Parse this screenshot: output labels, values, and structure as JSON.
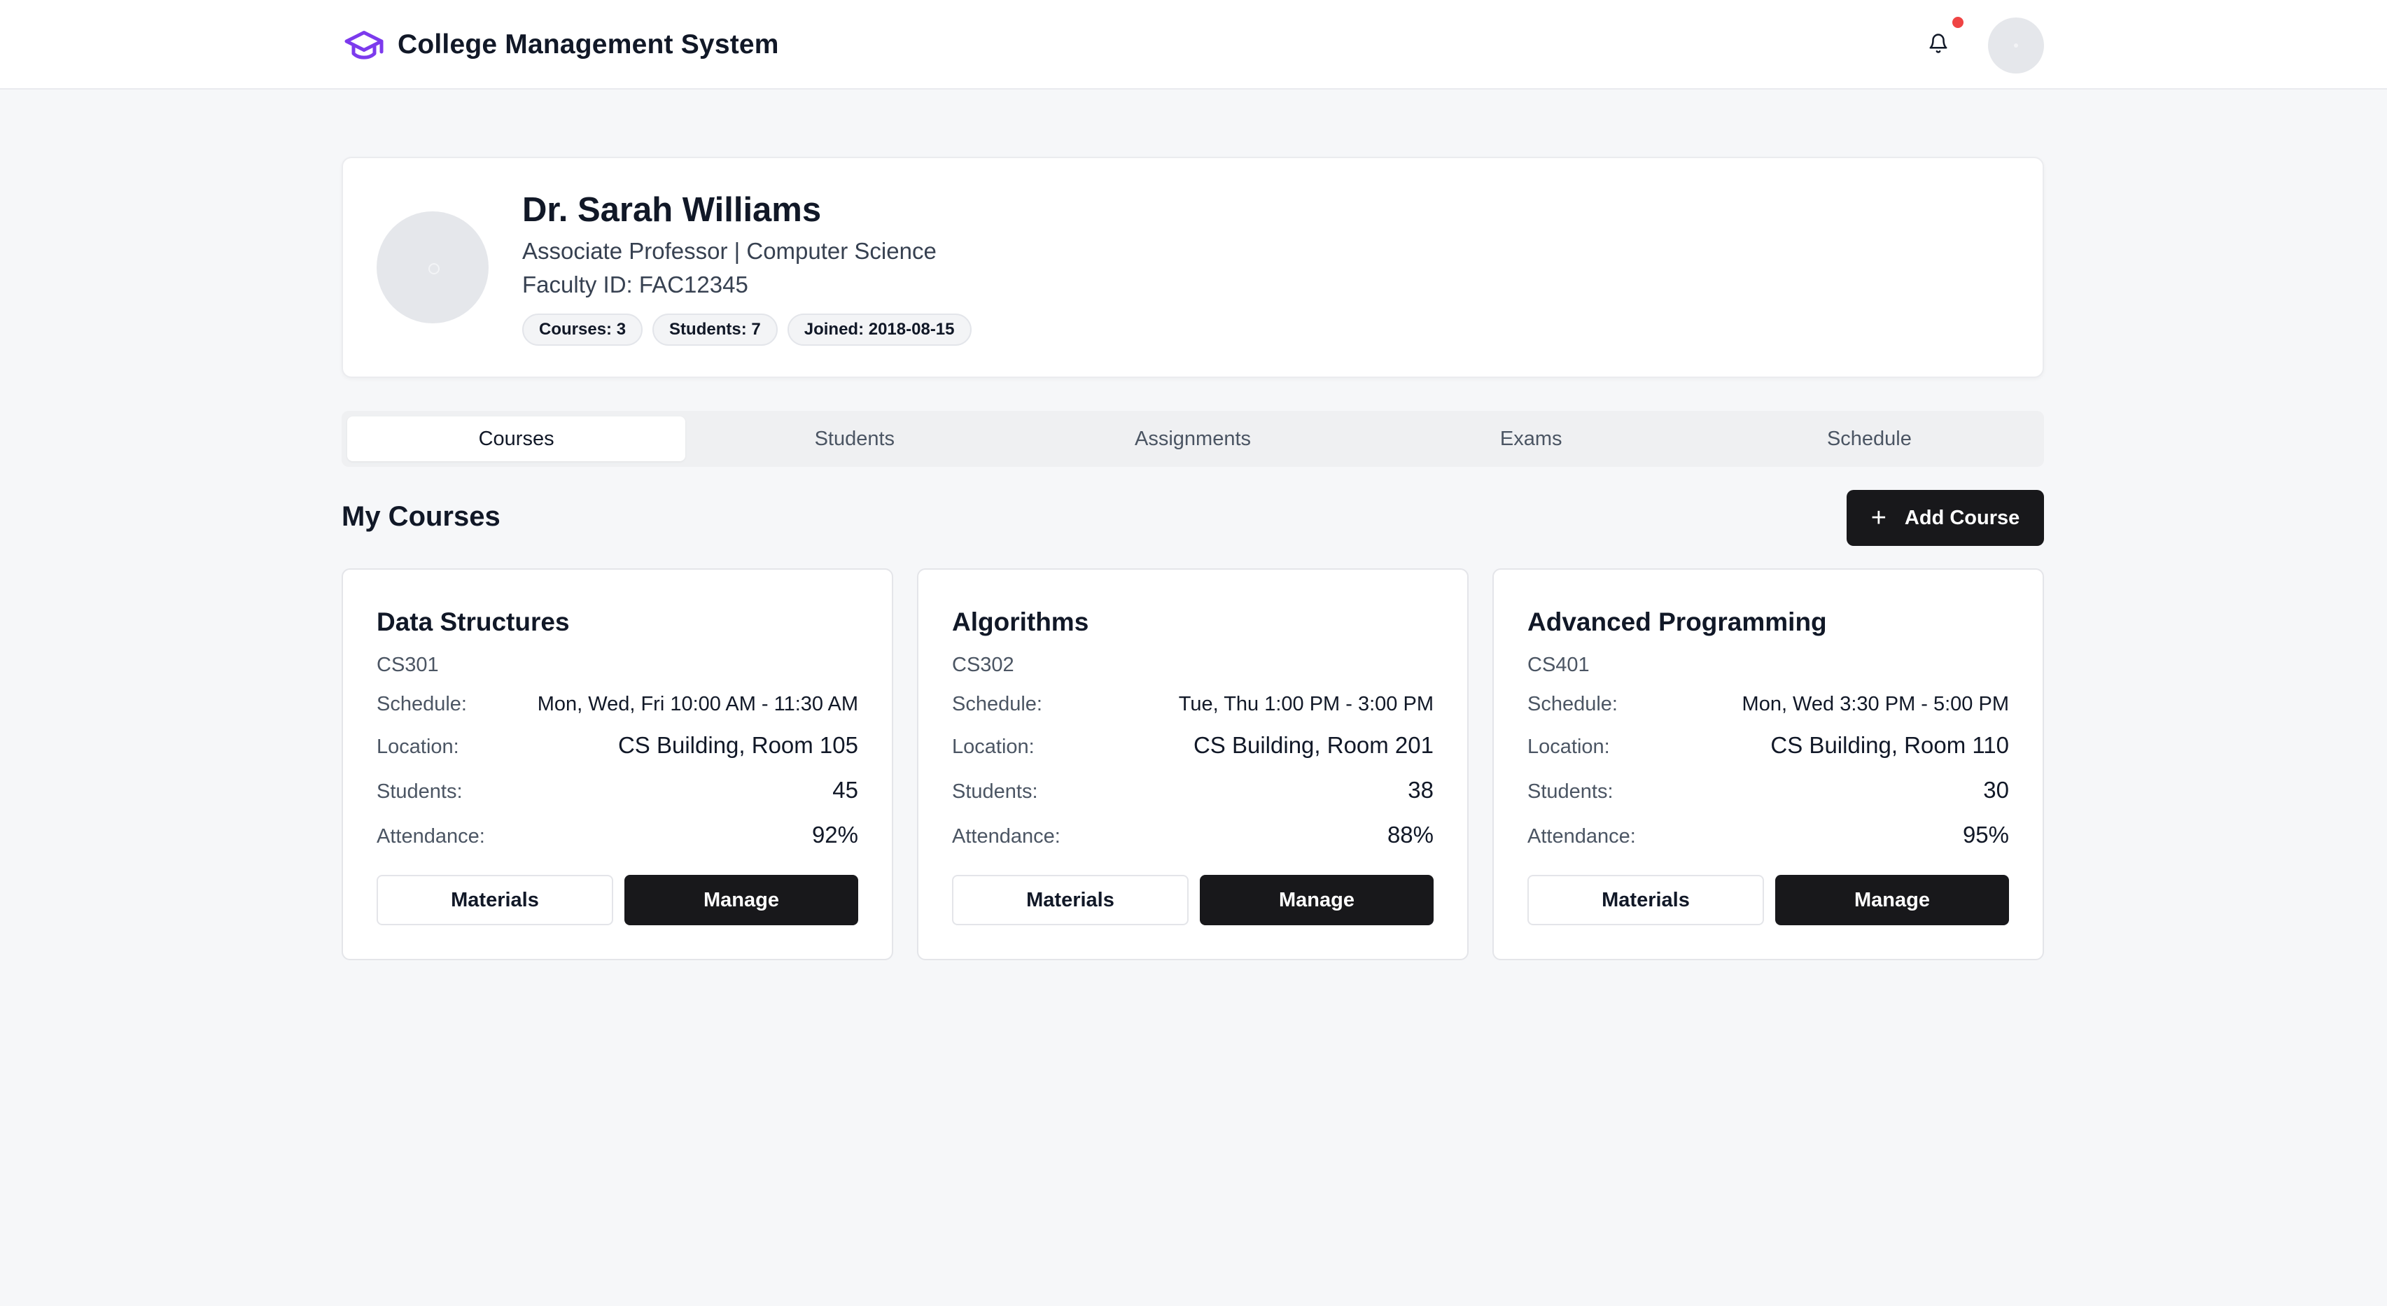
{
  "header": {
    "app_title": "College Management System",
    "brand_icon": "graduation-cap-icon",
    "brand_color": "#7c3aed",
    "notification_dot_color": "#ef4444"
  },
  "profile": {
    "name": "Dr. Sarah Williams",
    "role": "Associate Professor | Computer Science",
    "faculty_id": "Faculty ID: FAC12345",
    "chips": [
      "Courses: 3",
      "Students: 7",
      "Joined: 2018-08-15"
    ]
  },
  "tabs": [
    {
      "label": "Courses",
      "active": true
    },
    {
      "label": "Students",
      "active": false
    },
    {
      "label": "Assignments",
      "active": false
    },
    {
      "label": "Exams",
      "active": false
    },
    {
      "label": "Schedule",
      "active": false
    }
  ],
  "section": {
    "title": "My Courses",
    "add_label": "Add Course"
  },
  "labels": {
    "schedule": "Schedule:",
    "location": "Location:",
    "students": "Students:",
    "attendance": "Attendance:",
    "materials": "Materials",
    "manage": "Manage"
  },
  "courses": [
    {
      "title": "Data Structures",
      "code": "CS301",
      "schedule": "Mon, Wed, Fri 10:00 AM - 11:30 AM",
      "location": "CS Building, Room 105",
      "students": "45",
      "attendance": "92%"
    },
    {
      "title": "Algorithms",
      "code": "CS302",
      "schedule": "Tue, Thu 1:00 PM - 3:00 PM",
      "location": "CS Building, Room 201",
      "students": "38",
      "attendance": "88%"
    },
    {
      "title": "Advanced Programming",
      "code": "CS401",
      "schedule": "Mon, Wed 3:30 PM - 5:00 PM",
      "location": "CS Building, Room 110",
      "students": "30",
      "attendance": "95%"
    }
  ]
}
